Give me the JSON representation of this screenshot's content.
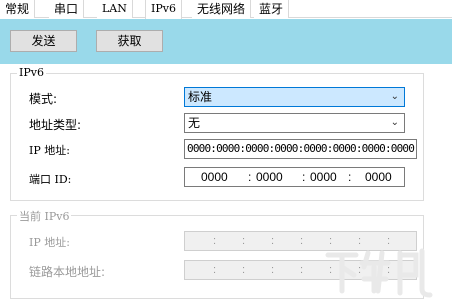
{
  "tabs": [
    "常规",
    "串口",
    "LAN",
    "IPv6",
    "无线网络",
    "蓝牙"
  ],
  "active_tab": "IPv6",
  "toolbar": {
    "send_label": "发送",
    "get_label": "获取"
  },
  "ipv6_group": {
    "title": "IPv6",
    "mode_label": "模式:",
    "mode_value": "标准",
    "addr_type_label": "地址类型:",
    "addr_type_value": "无",
    "ip_label": "IP 地址:",
    "ip_value": "0000:0000:0000:0000:0000:0000:0000:0000",
    "port_label": "端口 ID:",
    "port_values": [
      "0000",
      "0000",
      "0000",
      "0000"
    ]
  },
  "current_group": {
    "title": "当前 IPv6",
    "ip_label": "IP 地址:",
    "link_local_label": "链路本地地址:"
  },
  "watermark": "下载吧"
}
